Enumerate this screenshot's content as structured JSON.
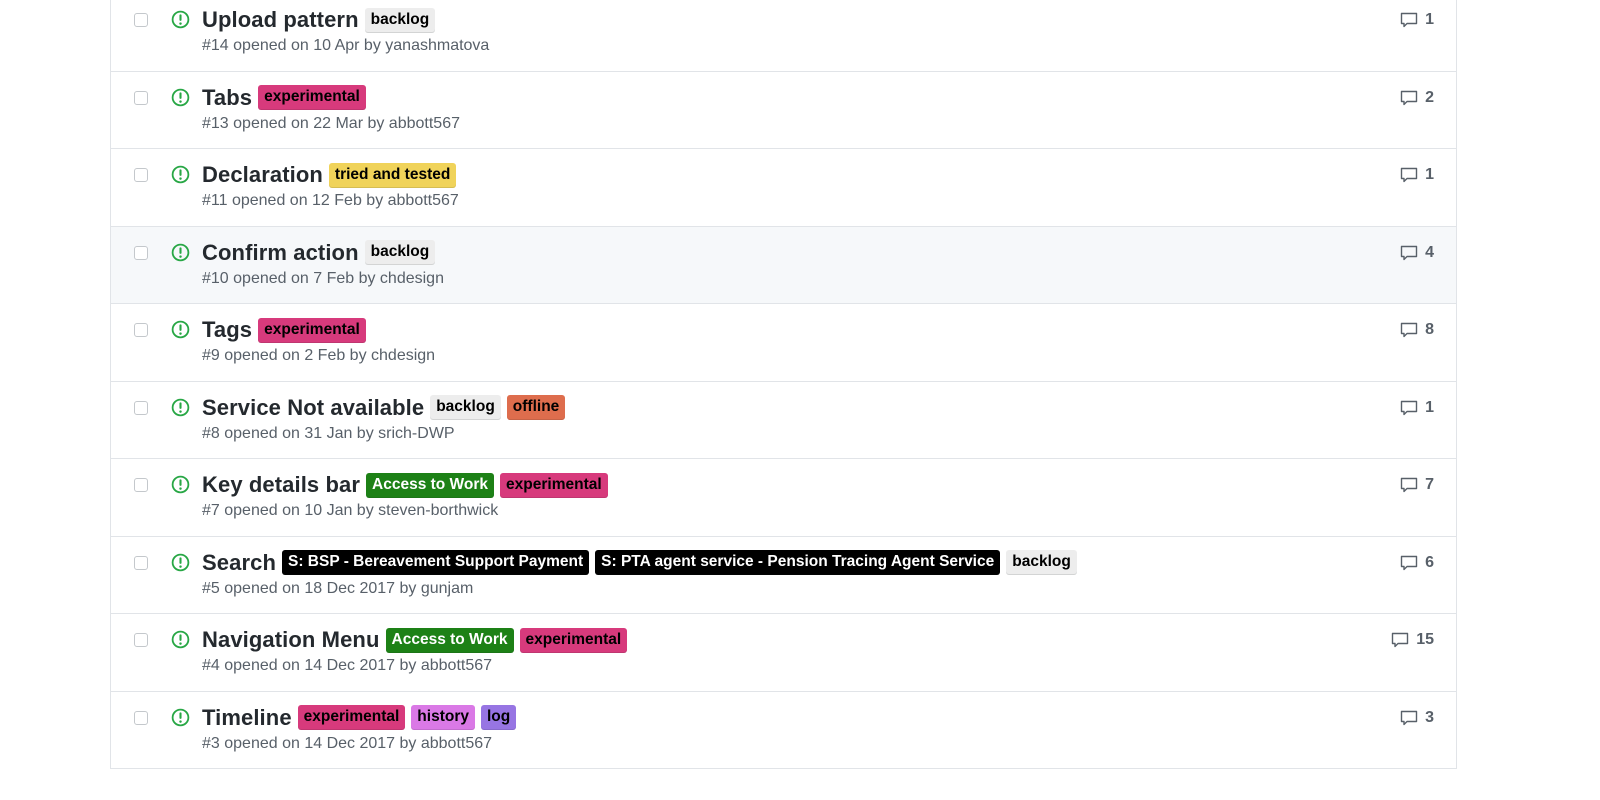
{
  "colors": {
    "open_icon": "#28a745",
    "row_hover_bg": "#f6f8fa",
    "meta_text": "#586069"
  },
  "issues": [
    {
      "title": "Upload pattern",
      "number": "#14",
      "meta": "#14 opened on 10 Apr by yanashmatova",
      "comments": "1",
      "labels": [
        {
          "text": "backlog",
          "bg": "#ededed",
          "fg": "#000000"
        }
      ]
    },
    {
      "title": "Tabs",
      "number": "#13",
      "meta": "#13 opened on 22 Mar by abbott567",
      "comments": "2",
      "labels": [
        {
          "text": "experimental",
          "bg": "#d73a7c",
          "fg": "#000000"
        }
      ]
    },
    {
      "title": "Declaration",
      "number": "#11",
      "meta": "#11 opened on 12 Feb by abbott567",
      "comments": "1",
      "labels": [
        {
          "text": "tried and tested",
          "bg": "#f0d35a",
          "fg": "#000000"
        }
      ]
    },
    {
      "title": "Confirm action",
      "number": "#10",
      "meta": "#10 opened on 7 Feb by chdesign",
      "comments": "4",
      "hover": true,
      "labels": [
        {
          "text": "backlog",
          "bg": "#ededed",
          "fg": "#000000"
        }
      ]
    },
    {
      "title": "Tags",
      "number": "#9",
      "meta": "#9 opened on 2 Feb by chdesign",
      "comments": "8",
      "labels": [
        {
          "text": "experimental",
          "bg": "#d73a7c",
          "fg": "#000000"
        }
      ]
    },
    {
      "title": "Service Not available",
      "number": "#8",
      "meta": "#8 opened on 31 Jan by srich-DWP",
      "comments": "1",
      "labels": [
        {
          "text": "backlog",
          "bg": "#ededed",
          "fg": "#000000"
        },
        {
          "text": "offline",
          "bg": "#de6d4d",
          "fg": "#000000"
        }
      ]
    },
    {
      "title": "Key details bar",
      "number": "#7",
      "meta": "#7 opened on 10 Jan by steven-borthwick",
      "comments": "7",
      "labels": [
        {
          "text": "Access to Work",
          "bg": "#1d8116",
          "fg": "#ffffff"
        },
        {
          "text": "experimental",
          "bg": "#d73a7c",
          "fg": "#000000"
        }
      ]
    },
    {
      "title": "Search",
      "number": "#5",
      "meta": "#5 opened on 18 Dec 2017 by gunjam",
      "comments": "6",
      "labels": [
        {
          "text": "S: BSP - Bereavement Support Payment",
          "bg": "#000000",
          "fg": "#ffffff"
        },
        {
          "text": "S: PTA agent service - Pension Tracing Agent Service",
          "bg": "#000000",
          "fg": "#ffffff"
        },
        {
          "text": "backlog",
          "bg": "#ededed",
          "fg": "#000000"
        }
      ]
    },
    {
      "title": "Navigation Menu",
      "number": "#4",
      "meta": "#4 opened on 14 Dec 2017 by abbott567",
      "comments": "15",
      "labels": [
        {
          "text": "Access to Work",
          "bg": "#1d8116",
          "fg": "#ffffff"
        },
        {
          "text": "experimental",
          "bg": "#d73a7c",
          "fg": "#000000"
        }
      ]
    },
    {
      "title": "Timeline",
      "number": "#3",
      "meta": "#3 opened on 14 Dec 2017 by abbott567",
      "comments": "3",
      "labels": [
        {
          "text": "experimental",
          "bg": "#d73a7c",
          "fg": "#000000"
        },
        {
          "text": "history",
          "bg": "#da79e6",
          "fg": "#000000"
        },
        {
          "text": "log",
          "bg": "#9775e3",
          "fg": "#000000"
        }
      ]
    }
  ]
}
